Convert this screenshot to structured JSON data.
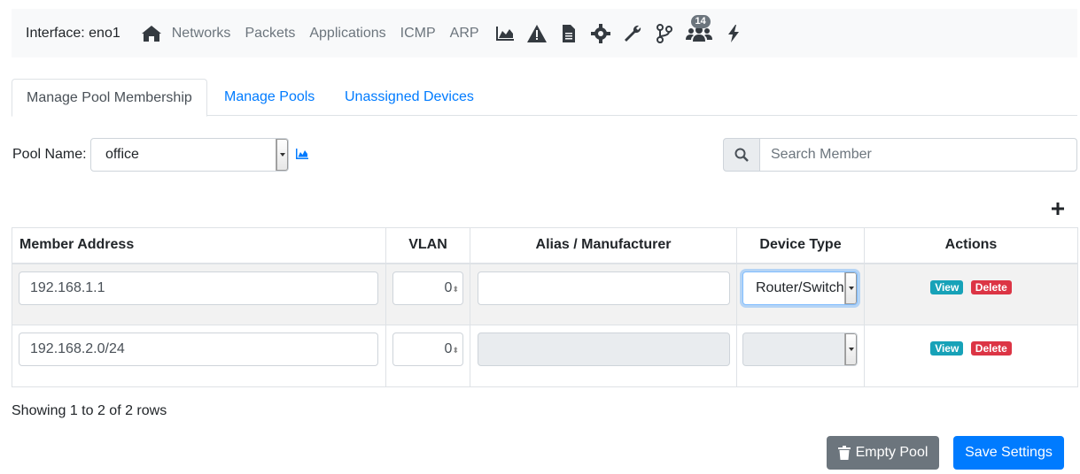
{
  "topbar": {
    "interface_label": "Interface: eno1",
    "nav": [
      "Networks",
      "Packets",
      "Applications",
      "ICMP",
      "ARP"
    ],
    "icons": [
      "home-icon",
      "area-chart-icon",
      "warning-icon",
      "file-icon",
      "gear-icon",
      "wrench-icon",
      "code-branch-icon",
      "users-icon",
      "bolt-icon"
    ],
    "users_badge": "14"
  },
  "tabs": [
    "Manage Pool Membership",
    "Manage Pools",
    "Unassigned Devices"
  ],
  "pool": {
    "label": "Pool Name:",
    "selected": "office"
  },
  "search": {
    "placeholder": "Search Member"
  },
  "table": {
    "headers": [
      "Member Address",
      "VLAN",
      "Alias / Manufacturer",
      "Device Type",
      "Actions"
    ],
    "rows": [
      {
        "address": "192.168.1.1",
        "vlan": "0",
        "alias": "",
        "device_type": "Router/Switch",
        "view": "View",
        "delete": "Delete"
      },
      {
        "address": "192.168.2.0/24",
        "vlan": "0",
        "alias": "",
        "device_type": "",
        "view": "View",
        "delete": "Delete"
      }
    ]
  },
  "footer": {
    "showing": "Showing 1 to 2 of 2 rows",
    "empty_pool": "Empty Pool",
    "save_settings": "Save Settings"
  },
  "colors": {
    "primary": "#007bff",
    "info": "#17a2b8",
    "danger": "#dc3545",
    "secondary": "#6c757d"
  }
}
